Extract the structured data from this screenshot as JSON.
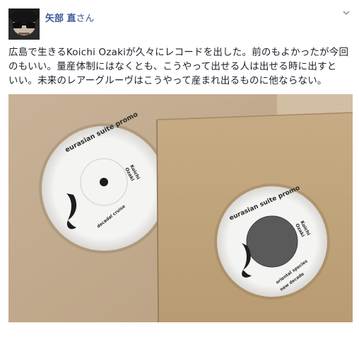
{
  "author": {
    "name": "矢部 直",
    "suffix": "さん"
  },
  "post": {
    "text_line1": "広島で生きるKoichi Ozakiが久々にレコードを出した。前のもよかったが今回",
    "text_line2": "のもいい。量産体制にはなくとも、こうやって出せる人は出せる時に出すと",
    "text_line3": "いい。未来のレアーグルーヴはこうやって産まれ出るものに他ならない。"
  },
  "photo": {
    "left_record": {
      "title": "eurasian suite promo",
      "artist_line1": "Koichi",
      "artist_line2": "Ozaki",
      "track": "decadal cruise"
    },
    "right_record": {
      "title": "eurasian suite promo",
      "artist_line1": "Koichi",
      "artist_line2": "Ozaki",
      "track_line1": "oriental species",
      "track_line2": "new decade"
    }
  },
  "icons": {
    "menu": "chevron-down-icon",
    "avatar": "profile-avatar"
  }
}
